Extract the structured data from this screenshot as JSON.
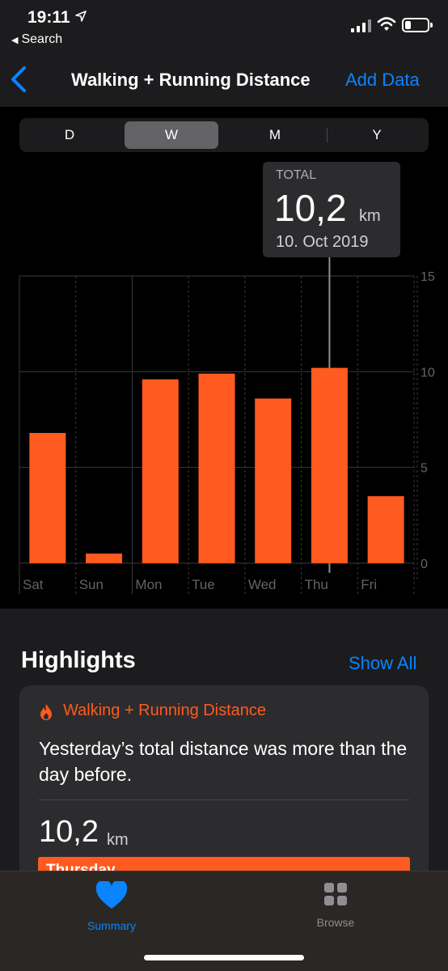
{
  "status_bar": {
    "time": "19:11",
    "back_app_label": "Search",
    "icons": [
      "location-arrow-icon",
      "cellular-signal-icon",
      "wifi-icon",
      "battery-icon"
    ]
  },
  "nav": {
    "back_icon": "chevron-left-icon",
    "title": "Walking + Running Distance",
    "add_label": "Add Data"
  },
  "segments": {
    "items": [
      "D",
      "W",
      "M",
      "Y"
    ],
    "selected": "W"
  },
  "tooltip": {
    "label": "TOTAL",
    "value": "10,2",
    "unit": "km",
    "date": "10. Oct 2019"
  },
  "chart_data": {
    "type": "bar",
    "categories": [
      "Sat",
      "Sun",
      "Mon",
      "Tue",
      "Wed",
      "Thu",
      "Fri"
    ],
    "values": [
      6.8,
      0.5,
      9.6,
      9.9,
      8.6,
      10.2,
      3.5
    ],
    "ylim": [
      0,
      15
    ],
    "yticks": [
      "0",
      "5",
      "10",
      "15"
    ],
    "highlighted": "Thu",
    "grid": true,
    "colors": {
      "bar": "#ff5a1f",
      "grid": "#3a3a3c"
    }
  },
  "highlights": {
    "title": "Highlights",
    "show_all_label": "Show All",
    "card": {
      "icon": "flame-icon",
      "heading": "Walking + Running Distance",
      "text": "Yesterday’s total distance was more than the day before.",
      "value": "10,2",
      "unit": "km",
      "bar_label": "Thursday"
    }
  },
  "tab_bar": {
    "items": [
      {
        "label": "Summary",
        "icon": "heart-icon",
        "active": true
      },
      {
        "label": "Browse",
        "icon": "grid-icon",
        "active": false
      }
    ]
  },
  "colors": {
    "accent": "#0a84ff",
    "orange": "#ff5a1f",
    "background": "#000000",
    "surface": "#1c1c1e"
  }
}
